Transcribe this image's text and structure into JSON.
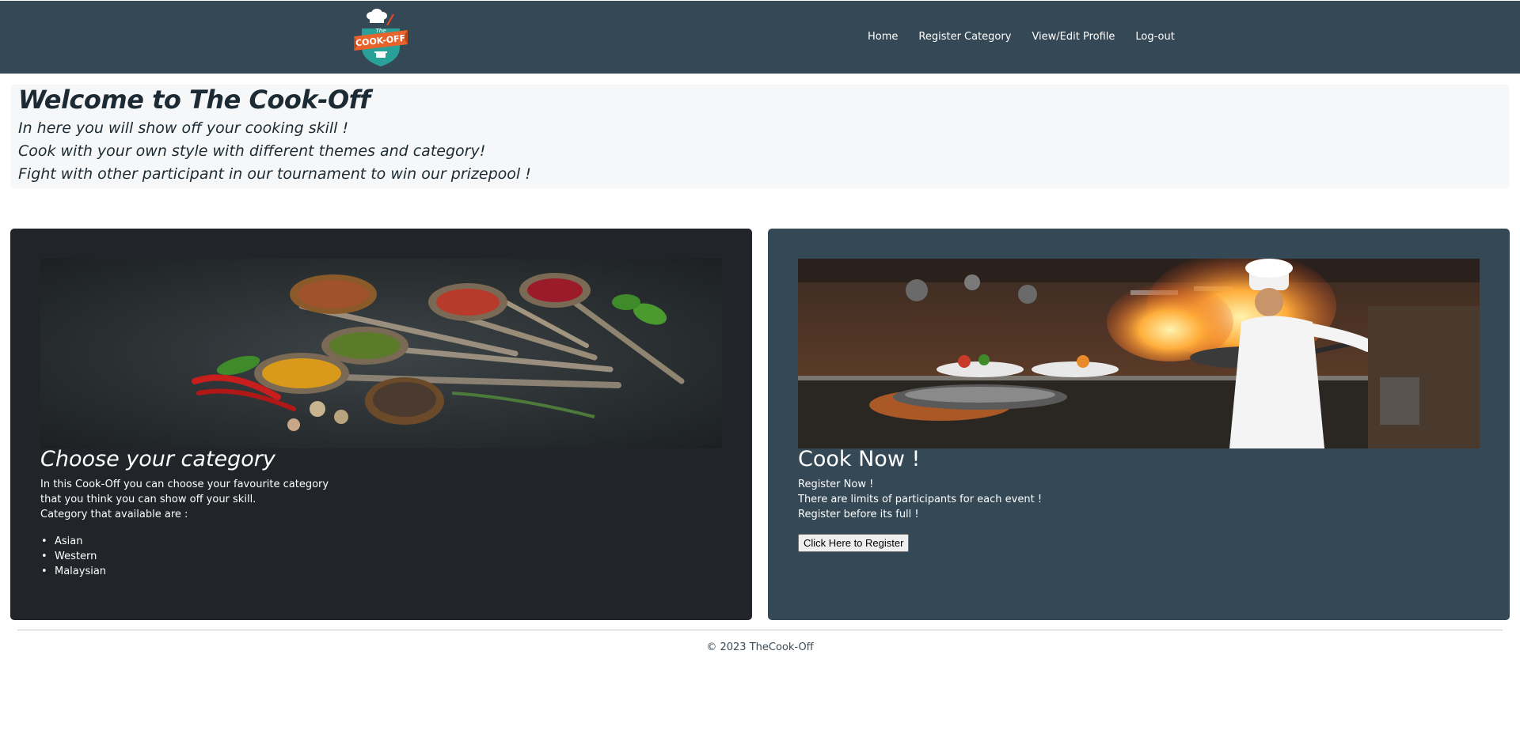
{
  "header": {
    "logo": {
      "text_top": "The",
      "text_main": "COOK-OFF",
      "icon": "chef-hat-logo"
    },
    "nav": [
      {
        "label": "Home"
      },
      {
        "label": "Register Category"
      },
      {
        "label": "View/Edit Profile"
      },
      {
        "label": "Log-out"
      }
    ],
    "background": "#344955"
  },
  "welcome": {
    "title": "Welcome to The Cook-Off",
    "lines": [
      "In here you will show off your cooking skill !",
      "Cook with your own style with different themes and category!",
      "Fight with other participant in our tournament to win our prizepool !"
    ]
  },
  "category_card": {
    "image": "spices-spoons-photo",
    "title": "Choose your category",
    "text_lines": [
      "In this Cook-Off you can choose your favourite category",
      "that you think you can show off your skill.",
      "Category that available are :"
    ],
    "categories": [
      "Asian",
      "Western",
      "Malaysian"
    ],
    "background": "#212529"
  },
  "register_card": {
    "image": "chef-flaming-pan-photo",
    "title": "Cook Now !",
    "text_lines": [
      "Register Now !",
      "There are limits of participants for each event !",
      "Register before its full !"
    ],
    "button_label": "Click Here to Register",
    "background": "#344955"
  },
  "footer": {
    "text": "© 2023 TheCook-Off"
  }
}
